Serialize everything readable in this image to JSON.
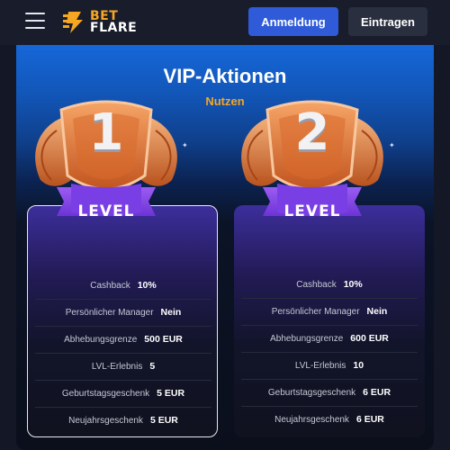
{
  "header": {
    "logo_line1": "BET",
    "logo_line2": "FLARE",
    "login_label": "Anmeldung",
    "register_label": "Eintragen"
  },
  "main": {
    "title": "VIP-Aktionen",
    "subtitle": "Nutzen"
  },
  "colors": {
    "accent": "#f5a623",
    "primary_button": "#2f5bd9",
    "badge_ribbon": "#7b3fe4",
    "badge_bronze": "#e07a3a"
  },
  "levels": [
    {
      "number": "1",
      "ribbon": "LEVEL",
      "selected": true,
      "rows": [
        {
          "label": "Cashback",
          "value": "10%"
        },
        {
          "label": "Persönlicher Manager",
          "value": "Nein"
        },
        {
          "label": "Abhebungsgrenze",
          "value": "500 EUR"
        },
        {
          "label": "LVL-Erlebnis",
          "value": "5"
        },
        {
          "label": "Geburtstagsgeschenk",
          "value": "5 EUR"
        },
        {
          "label": "Neujahrsgeschenk",
          "value": "5 EUR"
        }
      ]
    },
    {
      "number": "2",
      "ribbon": "LEVEL",
      "selected": false,
      "rows": [
        {
          "label": "Cashback",
          "value": "10%"
        },
        {
          "label": "Persönlicher Manager",
          "value": "Nein"
        },
        {
          "label": "Abhebungsgrenze",
          "value": "600 EUR"
        },
        {
          "label": "LVL-Erlebnis",
          "value": "10"
        },
        {
          "label": "Geburtstagsgeschenk",
          "value": "6 EUR"
        },
        {
          "label": "Neujahrsgeschenk",
          "value": "6 EUR"
        }
      ]
    }
  ]
}
